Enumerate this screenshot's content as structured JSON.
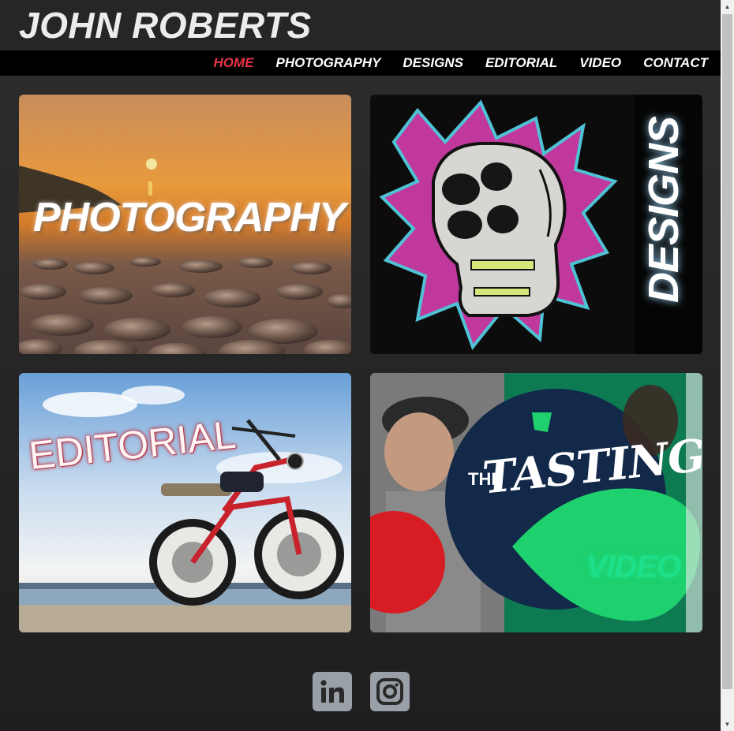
{
  "header": {
    "title": "JOHN ROBERTS"
  },
  "nav": {
    "items": [
      {
        "label": "HOME",
        "active": true
      },
      {
        "label": "PHOTOGRAPHY"
      },
      {
        "label": "DESIGNS"
      },
      {
        "label": "EDITORIAL"
      },
      {
        "label": "VIDEO"
      },
      {
        "label": "CONTACT"
      }
    ],
    "active_color": "#e8344a"
  },
  "tiles": {
    "photography": {
      "label": "PHOTOGRAPHY"
    },
    "designs": {
      "label": "DESIGNS"
    },
    "editorial": {
      "label": "EDITORIAL"
    },
    "video": {
      "label": "VIDEO",
      "show_the": "THE",
      "show_name": "TASTING"
    }
  },
  "socials": [
    {
      "icon": "linkedin-icon"
    },
    {
      "icon": "instagram-icon"
    }
  ]
}
